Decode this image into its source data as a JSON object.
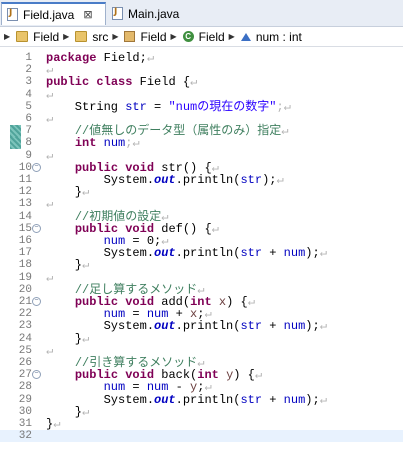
{
  "tabs": [
    {
      "label": "Field.java",
      "close": "⊠",
      "active": true
    },
    {
      "label": "Main.java",
      "active": false
    }
  ],
  "breadcrumb": {
    "items": [
      {
        "icon": "project-folder-icon",
        "label": "Field"
      },
      {
        "icon": "source-folder-icon",
        "label": "src"
      },
      {
        "icon": "package-icon",
        "label": "Field"
      },
      {
        "icon": "class-icon",
        "label": "Field"
      },
      {
        "icon": "field-icon",
        "label": "num : int"
      }
    ]
  },
  "editor": {
    "lines": [
      {
        "n": "1",
        "tokens": [
          {
            "t": "package",
            "c": "kw"
          },
          {
            "t": " Field;"
          },
          {
            "t": "↵",
            "c": "ws"
          }
        ]
      },
      {
        "n": "2",
        "tokens": [
          {
            "t": "↵",
            "c": "ws"
          }
        ]
      },
      {
        "n": "3",
        "tokens": [
          {
            "t": "public",
            "c": "kw"
          },
          {
            "t": " "
          },
          {
            "t": "class",
            "c": "kw"
          },
          {
            "t": " Field {"
          },
          {
            "t": "↵",
            "c": "ws"
          }
        ]
      },
      {
        "n": "4",
        "tokens": [
          {
            "t": "↵",
            "c": "ws"
          }
        ]
      },
      {
        "n": "5",
        "tokens": [
          {
            "t": "    String "
          },
          {
            "t": "str",
            "c": "fd"
          },
          {
            "t": " = "
          },
          {
            "t": "\"numの現在の数字\"",
            "c": "st"
          },
          {
            "t": ";↵",
            "c": "ws"
          }
        ]
      },
      {
        "n": "6",
        "tokens": [
          {
            "t": "↵",
            "c": "ws"
          }
        ]
      },
      {
        "n": "7",
        "tokens": [
          {
            "t": "    "
          },
          {
            "t": "//値無しのデータ型（属性のみ）指定",
            "c": "cm"
          },
          {
            "t": "↵",
            "c": "ws"
          }
        ],
        "marker": true
      },
      {
        "n": "8",
        "tokens": [
          {
            "t": "    "
          },
          {
            "t": "int",
            "c": "kw"
          },
          {
            "t": " "
          },
          {
            "t": "num",
            "c": "fd"
          },
          {
            "t": ";↵",
            "c": "ws"
          }
        ],
        "marker": true
      },
      {
        "n": "9",
        "tokens": [
          {
            "t": "↵",
            "c": "ws"
          }
        ]
      },
      {
        "n": "10",
        "tokens": [
          {
            "t": "    "
          },
          {
            "t": "public",
            "c": "kw"
          },
          {
            "t": " "
          },
          {
            "t": "void",
            "c": "kw"
          },
          {
            "t": " str() {"
          },
          {
            "t": "↵",
            "c": "ws"
          }
        ],
        "fold": true
      },
      {
        "n": "11",
        "tokens": [
          {
            "t": "        System."
          },
          {
            "t": "out",
            "c": "sf"
          },
          {
            "t": ".println("
          },
          {
            "t": "str",
            "c": "fd"
          },
          {
            "t": ");"
          },
          {
            "t": "↵",
            "c": "ws"
          }
        ]
      },
      {
        "n": "12",
        "tokens": [
          {
            "t": "    }"
          },
          {
            "t": "↵",
            "c": "ws"
          }
        ]
      },
      {
        "n": "13",
        "tokens": [
          {
            "t": "↵",
            "c": "ws"
          }
        ]
      },
      {
        "n": "14",
        "tokens": [
          {
            "t": "    "
          },
          {
            "t": "//初期値の設定",
            "c": "cm"
          },
          {
            "t": "↵",
            "c": "ws"
          }
        ]
      },
      {
        "n": "15",
        "tokens": [
          {
            "t": "    "
          },
          {
            "t": "public",
            "c": "kw"
          },
          {
            "t": " "
          },
          {
            "t": "void",
            "c": "kw"
          },
          {
            "t": " def() {"
          },
          {
            "t": "↵",
            "c": "ws"
          }
        ],
        "fold": true
      },
      {
        "n": "16",
        "tokens": [
          {
            "t": "        "
          },
          {
            "t": "num",
            "c": "fd"
          },
          {
            "t": " = 0;"
          },
          {
            "t": "↵",
            "c": "ws"
          }
        ]
      },
      {
        "n": "17",
        "tokens": [
          {
            "t": "        System."
          },
          {
            "t": "out",
            "c": "sf"
          },
          {
            "t": ".println("
          },
          {
            "t": "str",
            "c": "fd"
          },
          {
            "t": " + "
          },
          {
            "t": "num",
            "c": "fd"
          },
          {
            "t": ");"
          },
          {
            "t": "↵",
            "c": "ws"
          }
        ]
      },
      {
        "n": "18",
        "tokens": [
          {
            "t": "    }"
          },
          {
            "t": "↵",
            "c": "ws"
          }
        ]
      },
      {
        "n": "19",
        "tokens": [
          {
            "t": "↵",
            "c": "ws"
          }
        ]
      },
      {
        "n": "20",
        "tokens": [
          {
            "t": "    "
          },
          {
            "t": "//足し算するメソッド",
            "c": "cm"
          },
          {
            "t": "↵",
            "c": "ws"
          }
        ]
      },
      {
        "n": "21",
        "tokens": [
          {
            "t": "    "
          },
          {
            "t": "public",
            "c": "kw"
          },
          {
            "t": " "
          },
          {
            "t": "void",
            "c": "kw"
          },
          {
            "t": " add("
          },
          {
            "t": "int",
            "c": "kw"
          },
          {
            "t": " "
          },
          {
            "t": "x",
            "c": "pm"
          },
          {
            "t": ") {"
          },
          {
            "t": "↵",
            "c": "ws"
          }
        ],
        "fold": true
      },
      {
        "n": "22",
        "tokens": [
          {
            "t": "        "
          },
          {
            "t": "num",
            "c": "fd"
          },
          {
            "t": " = "
          },
          {
            "t": "num",
            "c": "fd"
          },
          {
            "t": " + "
          },
          {
            "t": "x",
            "c": "pm"
          },
          {
            "t": ";"
          },
          {
            "t": "↵",
            "c": "ws"
          }
        ]
      },
      {
        "n": "23",
        "tokens": [
          {
            "t": "        System."
          },
          {
            "t": "out",
            "c": "sf"
          },
          {
            "t": ".println("
          },
          {
            "t": "str",
            "c": "fd"
          },
          {
            "t": " + "
          },
          {
            "t": "num",
            "c": "fd"
          },
          {
            "t": ");"
          },
          {
            "t": "↵",
            "c": "ws"
          }
        ]
      },
      {
        "n": "24",
        "tokens": [
          {
            "t": "    }"
          },
          {
            "t": "↵",
            "c": "ws"
          }
        ]
      },
      {
        "n": "25",
        "tokens": [
          {
            "t": "↵",
            "c": "ws"
          }
        ]
      },
      {
        "n": "26",
        "tokens": [
          {
            "t": "    "
          },
          {
            "t": "//引き算するメソッド",
            "c": "cm"
          },
          {
            "t": "↵",
            "c": "ws"
          }
        ]
      },
      {
        "n": "27",
        "tokens": [
          {
            "t": "    "
          },
          {
            "t": "public",
            "c": "kw"
          },
          {
            "t": " "
          },
          {
            "t": "void",
            "c": "kw"
          },
          {
            "t": " back("
          },
          {
            "t": "int",
            "c": "kw"
          },
          {
            "t": " "
          },
          {
            "t": "y",
            "c": "pm"
          },
          {
            "t": ") {"
          },
          {
            "t": "↵",
            "c": "ws"
          }
        ],
        "fold": true
      },
      {
        "n": "28",
        "tokens": [
          {
            "t": "        "
          },
          {
            "t": "num",
            "c": "fd"
          },
          {
            "t": " = "
          },
          {
            "t": "num",
            "c": "fd"
          },
          {
            "t": " - "
          },
          {
            "t": "y",
            "c": "pm"
          },
          {
            "t": ";"
          },
          {
            "t": "↵",
            "c": "ws"
          }
        ]
      },
      {
        "n": "29",
        "tokens": [
          {
            "t": "        System."
          },
          {
            "t": "out",
            "c": "sf"
          },
          {
            "t": ".println("
          },
          {
            "t": "str",
            "c": "fd"
          },
          {
            "t": " + "
          },
          {
            "t": "num",
            "c": "fd"
          },
          {
            "t": ");"
          },
          {
            "t": "↵",
            "c": "ws"
          }
        ]
      },
      {
        "n": "30",
        "tokens": [
          {
            "t": "    }"
          },
          {
            "t": "↵",
            "c": "ws"
          }
        ]
      },
      {
        "n": "31",
        "tokens": [
          {
            "t": "}"
          },
          {
            "t": "↵",
            "c": "ws"
          }
        ]
      },
      {
        "n": "32",
        "tokens": [],
        "current": true
      }
    ]
  },
  "colors": {
    "keyword": "#7f0055",
    "comment": "#3f7f5f",
    "string": "#2a00ff",
    "field": "#0000c0",
    "parameter": "#6a3e3e",
    "current_line": "#e8f2fe"
  }
}
